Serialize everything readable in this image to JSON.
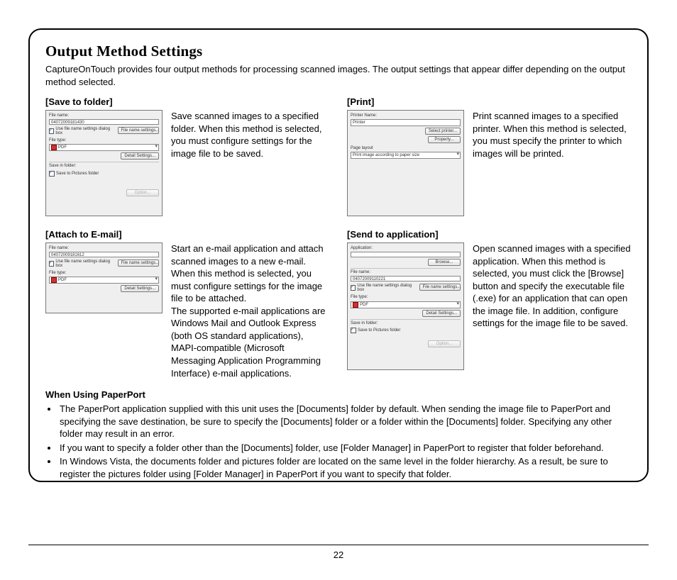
{
  "page_number": "22",
  "title": "Output Method Settings",
  "intro": "CaptureOnTouch provides four output methods for processing scanned images. The output settings that appear differ depending on the output method selected.",
  "left": {
    "save": {
      "heading": "[Save to folder]",
      "desc": "Save scanned images to a specified folder. When this method is selected, you must configure settings for the image file to be saved.",
      "panel": {
        "filename_label": "File name:",
        "filename_value": "04072009181430",
        "use_dialog_label": "Use file name settings dialog box",
        "file_name_settings_btn": "File name settings...",
        "filetype_label": "File type:",
        "filetype_value": "PDF",
        "detail_btn": "Detail Settings...",
        "save_in_label": "Save in folder:",
        "save_to_pictures_label": "Save to Pictures folder",
        "option_btn": "Option..."
      }
    },
    "email": {
      "heading": "[Attach to E-mail]",
      "desc": "Start an e-mail application and attach scanned images to a new e-mail. When this method is selected, you must configure settings for the image file to be attached.\nThe supported e-mail applications are Windows Mail and Outlook Express (both OS standard applications), MAPI-compatible (Microsoft Messaging Application Programming Interface) e-mail applications.",
      "panel": {
        "filename_label": "File name:",
        "filename_value": "04072009181612",
        "use_dialog_label": "Use file name settings dialog box",
        "file_name_settings_btn": "File name settings...",
        "filetype_label": "File type:",
        "filetype_value": "PDF",
        "detail_btn": "Detail Settings..."
      }
    }
  },
  "right": {
    "print": {
      "heading": "[Print]",
      "desc": "Print scanned images to a specified printer. When this method is selected, you must specify the printer to which images will be printed.",
      "panel": {
        "printer_name_label": "Printer Name:",
        "printer_value": "Printer",
        "select_printer_btn": "Select printer...",
        "property_btn": "Property...",
        "page_layout_label": "Page layout",
        "page_layout_value": "Print image according to paper size"
      }
    },
    "send": {
      "heading": "[Send to application]",
      "desc": "Open scanned images with a specified application. When this method is selected, you must click the [Browse] button and specify the executable file (.exe) for an application that can open the image file. In addition, configure settings for the image file to be saved.",
      "panel": {
        "application_label": "Application:",
        "browse_btn": "Browse...",
        "filename_label": "File name:",
        "filename_value": "04072009110221",
        "use_dialog_label": "Use file name settings dialog box",
        "file_name_settings_btn": "File name settings...",
        "filetype_label": "File type:",
        "filetype_value": "PDF",
        "detail_btn": "Detail Settings...",
        "save_in_label": "Save in folder:",
        "save_to_pictures_label": "Save to Pictures folder",
        "option_btn": "Option..."
      }
    }
  },
  "paperport": {
    "heading": "When Using PaperPort",
    "b1": "The PaperPort application supplied with this unit uses the [Documents] folder by default. When sending the image file to PaperPort and specifying the save destination, be sure to specify the [Documents] folder or a folder within the [Documents] folder. Specifying any other folder may result in an error.",
    "b2": "If you want to specify a folder other than the [Documents] folder, use [Folder Manager] in PaperPort to register that folder beforehand.",
    "b3": "In Windows Vista, the documents folder and pictures folder are located on the same level in the folder hierarchy. As a result, be sure to register the pictures folder using [Folder Manager] in PaperPort if you want to specify that folder."
  }
}
